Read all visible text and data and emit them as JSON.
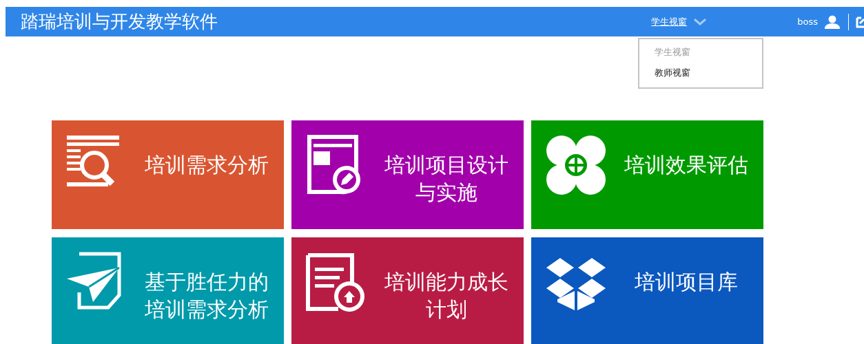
{
  "header": {
    "title": "踏瑞培训与开发教学软件",
    "view_switch": "学生视窗",
    "user": "boss"
  },
  "view_menu": [
    {
      "label": "学生视窗",
      "disabled": true
    },
    {
      "label": "教师视窗",
      "disabled": false
    }
  ],
  "tiles": [
    {
      "label": "培训需求分析",
      "kind": "search",
      "color": "#d95531"
    },
    {
      "label": "培训项目设计与实施",
      "kind": "design",
      "color": "#a200aa"
    },
    {
      "label": "培训效果评估",
      "kind": "clover",
      "color": "#009a00"
    },
    {
      "label": "基于胜任力的培训需求分析",
      "kind": "plane",
      "color": "#009aaa"
    },
    {
      "label": "培训能力成长计划",
      "kind": "upload",
      "color": "#b81c44"
    },
    {
      "label": "培训项目库",
      "kind": "box",
      "color": "#0b58bf"
    }
  ]
}
